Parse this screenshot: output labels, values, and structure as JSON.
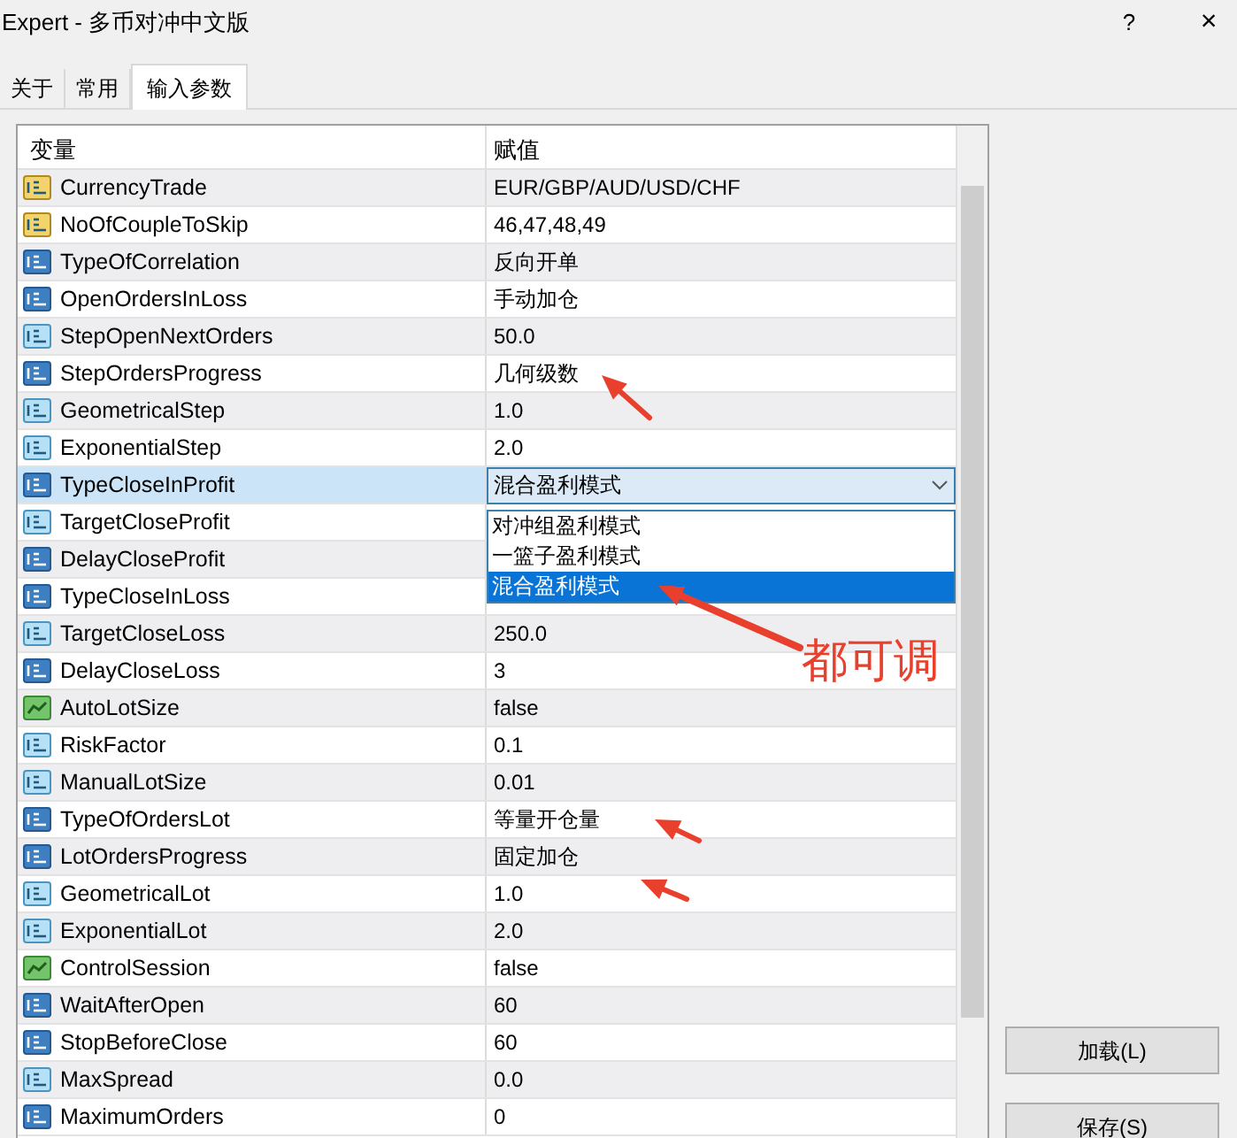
{
  "window": {
    "title": "Expert - 多币对冲中文版",
    "help": "?",
    "close": "×"
  },
  "tabs": [
    {
      "label": "关于",
      "selected": false
    },
    {
      "label": "常用",
      "selected": false
    },
    {
      "label": "输入参数",
      "selected": true
    }
  ],
  "table": {
    "columns": [
      "变量",
      "赋值"
    ],
    "rows": [
      {
        "name": "CurrencyTrade",
        "kind": "string",
        "value": "EUR/GBP/AUD/USD/CHF",
        "selected": false
      },
      {
        "name": "NoOfCoupleToSkip",
        "kind": "string",
        "value": "46,47,48,49",
        "selected": false
      },
      {
        "name": "TypeOfCorrelation",
        "kind": "int",
        "value": "反向开单",
        "selected": false
      },
      {
        "name": "OpenOrdersInLoss",
        "kind": "int",
        "value": "手动加仓",
        "selected": false
      },
      {
        "name": "StepOpenNextOrders",
        "kind": "double",
        "value": "50.0",
        "selected": false
      },
      {
        "name": "StepOrdersProgress",
        "kind": "int",
        "value": "几何级数",
        "selected": false
      },
      {
        "name": "GeometricalStep",
        "kind": "double",
        "value": "1.0",
        "selected": false
      },
      {
        "name": "ExponentialStep",
        "kind": "double",
        "value": "2.0",
        "selected": false
      },
      {
        "name": "TypeCloseInProfit",
        "kind": "int",
        "value": "混合盈利模式",
        "selected": true
      },
      {
        "name": "TargetCloseProfit",
        "kind": "double",
        "selected": false
      },
      {
        "name": "DelayCloseProfit",
        "kind": "int",
        "selected": false
      },
      {
        "name": "TypeCloseInLoss",
        "kind": "int",
        "selected": false
      },
      {
        "name": "TargetCloseLoss",
        "kind": "double",
        "value": "250.0",
        "selected": false
      },
      {
        "name": "DelayCloseLoss",
        "kind": "int",
        "value": "3",
        "selected": false
      },
      {
        "name": "AutoLotSize",
        "kind": "bool",
        "value": "false",
        "selected": false
      },
      {
        "name": "RiskFactor",
        "kind": "double",
        "value": "0.1",
        "selected": false
      },
      {
        "name": "ManualLotSize",
        "kind": "double",
        "value": "0.01",
        "selected": false
      },
      {
        "name": "TypeOfOrdersLot",
        "kind": "int",
        "value": "等量开仓量",
        "selected": false
      },
      {
        "name": "LotOrdersProgress",
        "kind": "int",
        "value": "固定加仓",
        "selected": false
      },
      {
        "name": "GeometricalLot",
        "kind": "double",
        "value": "1.0",
        "selected": false
      },
      {
        "name": "ExponentialLot",
        "kind": "double",
        "value": "2.0",
        "selected": false
      },
      {
        "name": "ControlSession",
        "kind": "bool",
        "value": "false",
        "selected": false
      },
      {
        "name": "WaitAfterOpen",
        "kind": "int",
        "value": "60",
        "selected": false
      },
      {
        "name": "StopBeforeClose",
        "kind": "int",
        "value": "60",
        "selected": false
      },
      {
        "name": "MaxSpread",
        "kind": "double",
        "value": "0.0",
        "selected": false
      },
      {
        "name": "MaximumOrders",
        "kind": "int",
        "value": "0",
        "selected": false
      }
    ]
  },
  "dropdown": {
    "options": [
      {
        "label": "对冲组盈利模式",
        "selected": false
      },
      {
        "label": "一篮子盈利模式",
        "selected": false
      },
      {
        "label": "混合盈利模式",
        "selected": true
      }
    ]
  },
  "annotation": {
    "label": "都可调"
  },
  "buttons": [
    "加载(L)",
    "保存(S)"
  ]
}
